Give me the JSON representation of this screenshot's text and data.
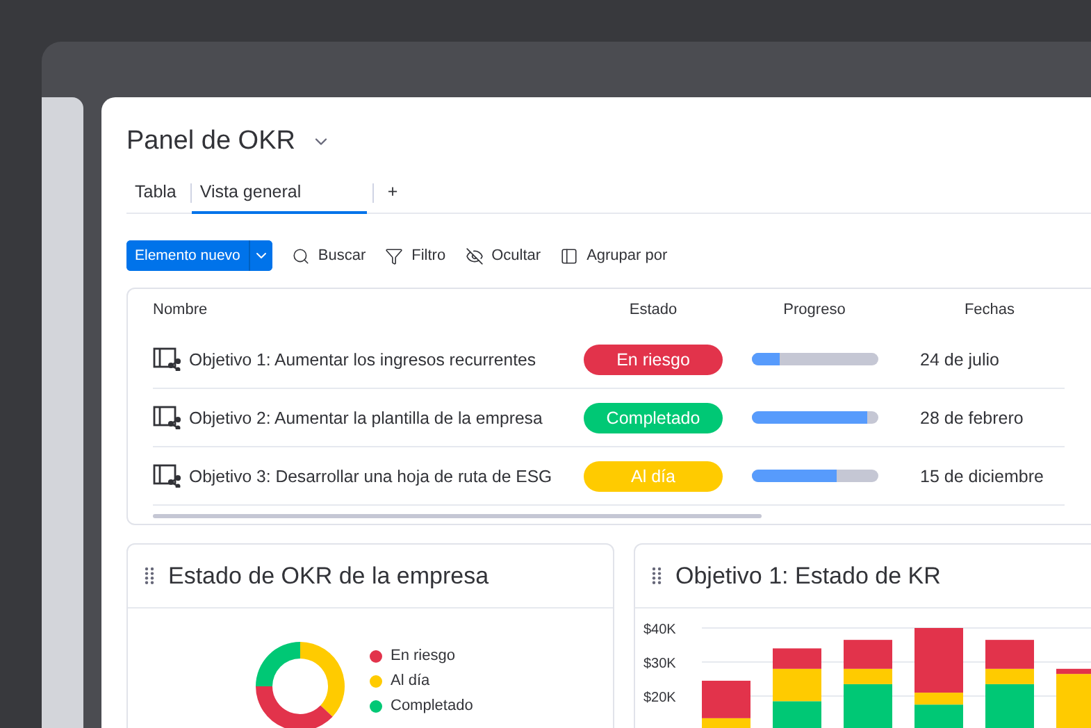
{
  "board": {
    "title": "Panel de OKR"
  },
  "tabs": [
    {
      "label": "Tabla",
      "selected": false
    },
    {
      "label": "Vista general",
      "selected": true
    },
    {
      "label": "+",
      "selected": false
    }
  ],
  "toolbar": {
    "new_item": "Elemento nuevo",
    "actions": [
      {
        "kind": "search",
        "label": "Buscar"
      },
      {
        "kind": "filter",
        "label": "Filtro"
      },
      {
        "kind": "hide",
        "label": "Ocultar"
      },
      {
        "kind": "group",
        "label": "Agrupar por"
      }
    ]
  },
  "table": {
    "columns": [
      "Nombre",
      "Estado",
      "Progreso",
      "Fechas"
    ],
    "rows": [
      {
        "name": "Objetivo 1: Aumentar los ingresos recurrentes",
        "status": "En riesgo",
        "color": "#e2334b",
        "level": 0.22,
        "date": "24 de julio"
      },
      {
        "name": "Objetivo 2: Aumentar la plantilla de la empresa",
        "status": "Completado",
        "color": "#00c875",
        "level": 0.92,
        "date": "28 de febrero"
      },
      {
        "name": "Objetivo 3: Desarrollar una hoja de ruta de ESG",
        "status": "Al día",
        "color": "#ffcb00",
        "level": 0.68,
        "date": "15 de diciembre"
      }
    ]
  },
  "widgets": [
    {
      "kind": "donut",
      "title": "Estado de OKR de la empresa",
      "legend": [
        {
          "label": "En riesgo",
          "color": "#e2334b"
        },
        {
          "label": "Al día",
          "color": "#ffcb00"
        },
        {
          "label": "Completado",
          "color": "#00c875"
        }
      ]
    },
    {
      "kind": "bar",
      "title": "Objetivo 1: Estado de KR",
      "axis_labels": [
        "$40K",
        "$30K",
        "$20K"
      ]
    }
  ]
}
